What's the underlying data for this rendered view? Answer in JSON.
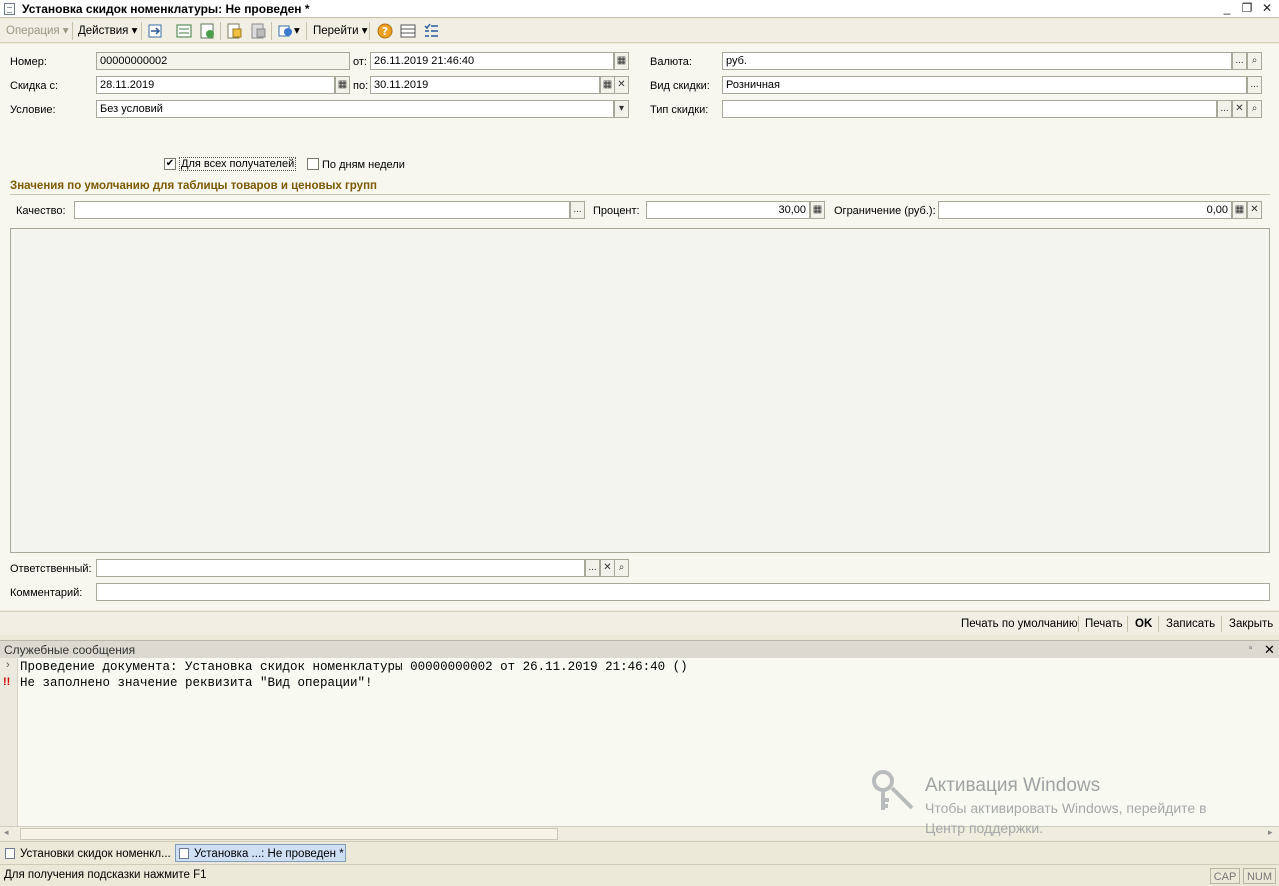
{
  "window": {
    "title": "Установка скидок номенклатуры: Не проведен *",
    "minimize": "_",
    "restore": "❐",
    "close": "✕"
  },
  "toolbar": {
    "operation": "Операция",
    "actions": "Действия",
    "goto": "Перейти"
  },
  "form": {
    "number_label": "Номер:",
    "number_value": "00000000002",
    "from_label": "от:",
    "from_value": "26.11.2019 21:46:40",
    "discount_from_label": "Скидка с:",
    "discount_from_value": "28.11.2019",
    "to_label": "по:",
    "to_value": "30.11.2019",
    "condition_label": "Условие:",
    "condition_value": "Без условий",
    "currency_label": "Валюта:",
    "currency_value": "руб.",
    "discount_kind_label": "Вид скидки:",
    "discount_kind_value": "Розничная",
    "discount_type_label": "Тип скидки:",
    "discount_type_value": "",
    "all_recipients_label": "Для всех получателей",
    "all_recipients_checked": true,
    "by_weekdays_label": "По дням недели",
    "by_weekdays_checked": false,
    "section_title": "Значения по умолчанию для таблицы товаров и ценовых групп",
    "quality_label": "Качество:",
    "quality_value": "",
    "percent_label": "Процент:",
    "percent_value": "30,00",
    "limit_label": "Ограничение (руб.):",
    "limit_value": "0,00",
    "responsible_label": "Ответственный:",
    "responsible_value": "",
    "comment_label": "Комментарий:",
    "comment_value": ""
  },
  "buttons": {
    "print_default": "Печать по умолчанию",
    "print": "Печать",
    "ok": "OK",
    "save": "Записать",
    "close": "Закрыть"
  },
  "messages": {
    "title": "Служебные сообщения",
    "lines": [
      {
        "marker": "›",
        "text": "Проведение документа: Установка скидок номенклатуры 00000000002 от 26.11.2019 21:46:40 ()"
      },
      {
        "marker": "!!",
        "text": "Не заполнено значение реквизита \"Вид операции\"!"
      }
    ]
  },
  "taskbar": {
    "tasks": [
      "Установки скидок номенкл...",
      "Установка ...: Не проведен *"
    ]
  },
  "statusbar": {
    "hint": "Для получения подсказки нажмите F1",
    "cap": "CAP",
    "num": "NUM"
  },
  "watermark": {
    "title": "Активация Windows",
    "line1": "Чтобы активировать Windows, перейдите в",
    "line2": "Центр поддержки."
  },
  "colors": {
    "section_title": "#7d5a00",
    "error_marker": "#cc0000",
    "active_task": "#cfe0f4"
  }
}
